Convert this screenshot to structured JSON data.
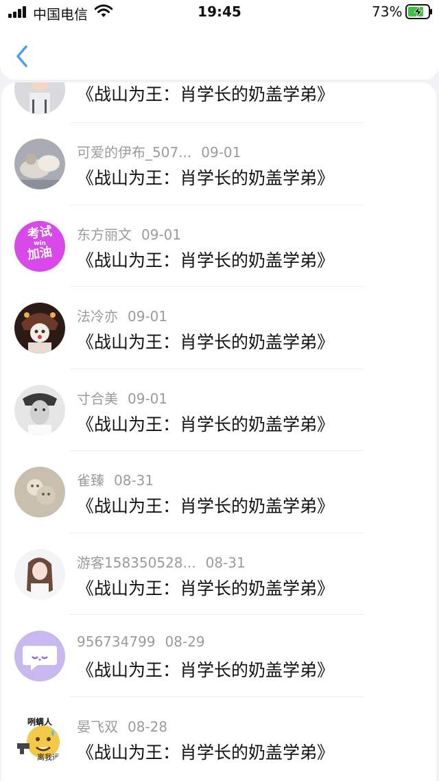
{
  "status_bar": {
    "carrier": "中国电信",
    "time": "19:45",
    "battery": "73%"
  },
  "nav": {
    "back_icon": "chevron-left-icon"
  },
  "partial_item": {
    "title": "《战山为王：肖学长的奶盖学弟》"
  },
  "items": [
    {
      "username": "可爱的伊布_507...",
      "date": "09-01",
      "title": "《战山为王：肖学长的奶盖学弟》",
      "avatar_theme": "#a9adb3"
    },
    {
      "username": "东方丽文",
      "date": "09-01",
      "title": "《战山为王：肖学长的奶盖学弟》",
      "avatar_theme": "#d948e8",
      "avatar_text": [
        "考试",
        "加油"
      ],
      "avatar_small": "win"
    },
    {
      "username": "法冷亦",
      "date": "09-01",
      "title": "《战山为王：肖学长的奶盖学弟》",
      "avatar_theme": "#6b3a2a"
    },
    {
      "username": "寸合美",
      "date": "09-01",
      "title": "《战山为王：肖学长的奶盖学弟》",
      "avatar_theme": "#9a9a9a"
    },
    {
      "username": "雀臻",
      "date": "08-31",
      "title": "《战山为王：肖学长的奶盖学弟》",
      "avatar_theme": "#c9bfae"
    },
    {
      "username": "游客158350528...",
      "date": "08-31",
      "title": "《战山为王：肖学长的奶盖学弟》",
      "avatar_theme": "#cfd8dc"
    },
    {
      "username": "956734799",
      "date": "08-29",
      "title": "《战山为王：肖学长的奶盖学弟》",
      "avatar_theme": "#c9b8f0"
    },
    {
      "username": "晏飞双",
      "date": "08-28",
      "title": "《战山为王：肖学长的奶盖学弟》",
      "avatar_theme": "#f3c94b",
      "avatar_text": [
        "咧螨人",
        "离我远"
      ]
    }
  ]
}
